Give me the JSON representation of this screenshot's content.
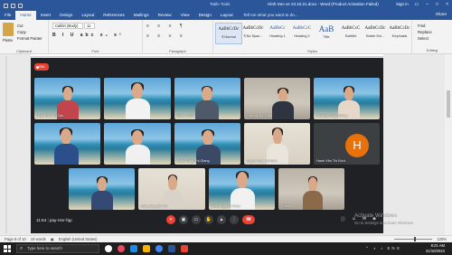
{
  "titlebar": {
    "context": "Table Tools",
    "title": "Hình Seo ve 23.10.21.docx - Word (Product Activation Failed)",
    "sign_in": "Sign in"
  },
  "tabs": [
    "File",
    "Home",
    "Insert",
    "Design",
    "Layout",
    "References",
    "Mailings",
    "Review",
    "View",
    "Design",
    "Layout"
  ],
  "tell_me": "Tell me what you want to do...",
  "share": "Share",
  "ribbon": {
    "paste": "Paste",
    "cut": "Cut",
    "copy": "Copy",
    "format_painter": "Format Painter",
    "clipboard": "Clipboard",
    "font_name": "Calibri (Body)",
    "font_size": "11",
    "font_buttons": "B I U abc x₂ x²",
    "font_group": "Font",
    "paragraph_group": "Paragraph",
    "styles_group": "Styles",
    "editing_group": "Editing",
    "find": "Find",
    "replace": "Replace",
    "select": "Select",
    "styles": [
      {
        "sample": "AaBbCcDc",
        "name": "¶ Normal"
      },
      {
        "sample": "AaBbCcDc",
        "name": "¶ No Spac..."
      },
      {
        "sample": "AaBbCc",
        "name": "Heading 1"
      },
      {
        "sample": "AaBbCcC",
        "name": "Heading 2"
      },
      {
        "sample": "AaB",
        "name": "Title"
      },
      {
        "sample": "AaBbCcC",
        "name": "Subtitle"
      },
      {
        "sample": "AaBbCcDc",
        "name": "Subtle Em..."
      },
      {
        "sample": "AaBbCcDc",
        "name": "Emphasis"
      }
    ]
  },
  "meeting": {
    "record": "Ghi",
    "time": "11:54",
    "code": "pay-rsnr-fqp",
    "participants": [
      {
        "name": "Trần Thị Thu Cần"
      },
      {
        "name": ""
      },
      {
        "name": "Ninh Thị Ái"
      },
      {
        "name": "Dương Thị Thao"
      },
      {
        "name": "Trương Công Giảng"
      },
      {
        "name": ""
      },
      {
        "name": ""
      },
      {
        "name": "Tuấn Tổng Thị Giang"
      },
      {
        "name": "Huỳnh Văn Thị Bích"
      },
      {
        "name": "Hạnh Văn Thị Bích"
      },
      {
        "name": ""
      },
      {
        "name": "Đặng Nguyễn Thị"
      },
      {
        "name": "Trần Nguyễn Hoàn"
      },
      {
        "name": "Phân"
      }
    ],
    "avatar_letter": "H",
    "activate_title": "Activate Windows",
    "activate_sub": "Go to Settings to activate Windows."
  },
  "status": {
    "page": "Page 9 of 10",
    "words": "19 words",
    "language": "English (United States)",
    "zoom": "120%"
  },
  "taskbar": {
    "search_placeholder": "Type here to search",
    "time": "8:21 AM",
    "date": "31/10/2024",
    "tray": "ENG"
  }
}
